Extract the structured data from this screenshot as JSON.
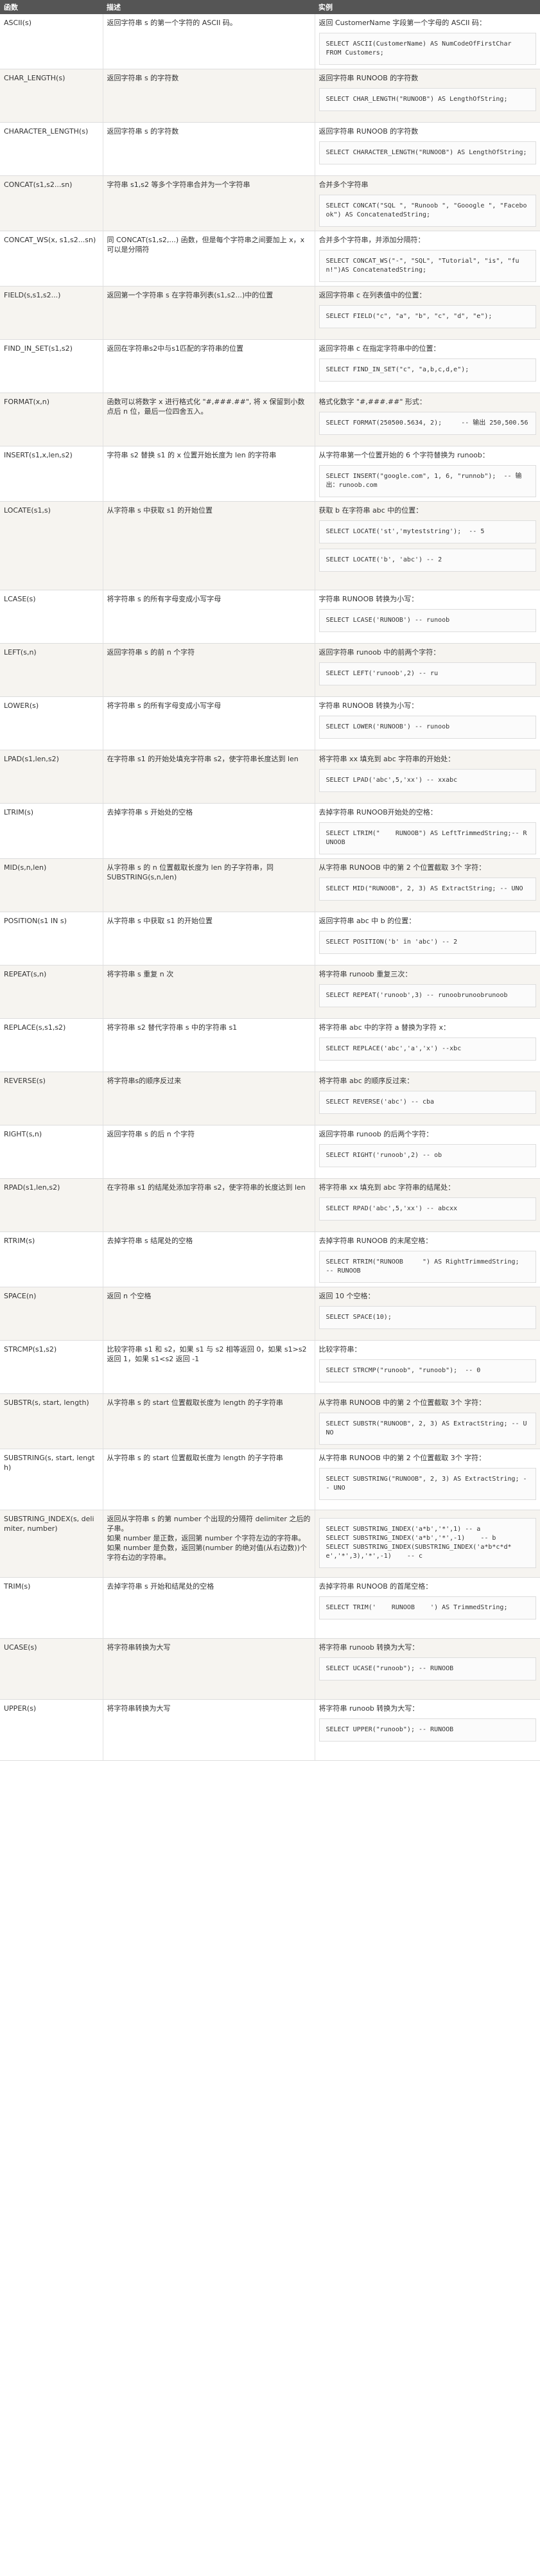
{
  "headers": [
    "函数",
    "描述",
    "实例"
  ],
  "rows": [
    {
      "fn": "ASCII(s)",
      "desc": "返回字符串 s 的第一个字符的 ASCII 码。",
      "example": "返回 CustomerName 字段第一个字母的 ASCII 码：",
      "codes": [
        "SELECT ASCII(CustomerName) AS NumCodeOfFirstChar\nFROM Customers;"
      ],
      "h": 75
    },
    {
      "fn": "CHAR_LENGTH(s)",
      "desc": "返回字符串 s 的字符数",
      "example": "返回字符串 RUNOOB 的字符数",
      "codes": [
        "SELECT CHAR_LENGTH(\"RUNOOB\") AS LengthOfString;"
      ],
      "h": 83
    },
    {
      "fn": "CHARACTER_LENGTH(s)",
      "desc": "返回字符串 s 的字符数",
      "example": "返回字符串 RUNOOB 的字符数",
      "codes": [
        "SELECT CHARACTER_LENGTH(\"RUNOOB\") AS LengthOfString;"
      ],
      "h": 83
    },
    {
      "fn": "CONCAT(s1,s2...sn)",
      "desc": "字符串 s1,s2 等多个字符串合并为一个字符串",
      "example": "合并多个字符串",
      "codes": [
        "SELECT CONCAT(\"SQL \", \"Runoob \", \"Gooogle \", \"Facebook\") AS ConcatenatedString;"
      ],
      "h": 83
    },
    {
      "fn": "CONCAT_WS(x, s1,s2...sn)",
      "desc": "同 CONCAT(s1,s2,...) 函数，但是每个字符串之间要加上 x，x 可以是分隔符",
      "example": "合并多个字符串，并添加分隔符：",
      "codes": [
        "SELECT CONCAT_WS(\"-\", \"SQL\", \"Tutorial\", \"is\", \"fun!\")AS ConcatenatedString;"
      ],
      "h": 83
    },
    {
      "fn": "FIELD(s,s1,s2...)",
      "desc": "返回第一个字符串 s 在字符串列表(s1,s2...)中的位置",
      "example": "返回字符串 c 在列表值中的位置：",
      "codes": [
        "SELECT FIELD(\"c\", \"a\", \"b\", \"c\", \"d\", \"e\");"
      ],
      "h": 83
    },
    {
      "fn": "FIND_IN_SET(s1,s2)",
      "desc": "返回在字符串s2中与s1匹配的字符串的位置",
      "example": "返回字符串 c 在指定字符串中的位置：",
      "codes": [
        "SELECT FIND_IN_SET(\"c\", \"a,b,c,d,e\");"
      ],
      "h": 83
    },
    {
      "fn": "FORMAT(x,n)",
      "desc": "函数可以将数字 x 进行格式化 \"#,###.##\", 将 x 保留到小数点后 n 位，最后一位四舍五入。",
      "example": "格式化数字 \"#,###.##\" 形式：",
      "codes": [
        "SELECT FORMAT(250500.5634, 2);     -- 输出 250,500.56"
      ],
      "h": 83
    },
    {
      "fn": "INSERT(s1,x,len,s2)",
      "desc": "字符串 s2 替换 s1 的 x 位置开始长度为 len 的字符串",
      "example": "从字符串第一个位置开始的 6 个字符替换为 runoob：",
      "codes": [
        "SELECT INSERT(\"google.com\", 1, 6, \"runnob\");  -- 输出：runoob.com"
      ],
      "h": 83
    },
    {
      "fn": "LOCATE(s1,s)",
      "desc": "从字符串 s 中获取 s1 的开始位置",
      "example": "获取 b 在字符串 abc 中的位置：",
      "codes": [
        "SELECT LOCATE('st','myteststring');  -- 5",
        "SELECT LOCATE('b', 'abc') -- 2"
      ],
      "h": 138
    },
    {
      "fn": "LCASE(s)",
      "desc": "将字符串 s 的所有字母变成小写字母",
      "example": "字符串 RUNOOB 转换为小写：",
      "codes": [
        "SELECT LCASE('RUNOOB') -- runoob"
      ],
      "h": 83
    },
    {
      "fn": "LEFT(s,n)",
      "desc": "返回字符串 s 的前 n 个字符",
      "example": "返回字符串 runoob 中的前两个字符：",
      "codes": [
        "SELECT LEFT('runoob',2) -- ru"
      ],
      "h": 83
    },
    {
      "fn": "LOWER(s)",
      "desc": "将字符串 s 的所有字母变成小写字母",
      "example": "字符串 RUNOOB 转换为小写：",
      "codes": [
        "SELECT LOWER('RUNOOB') -- runoob"
      ],
      "h": 83
    },
    {
      "fn": "LPAD(s1,len,s2)",
      "desc": "在字符串 s1 的开始处填充字符串 s2，使字符串长度达到 len",
      "example": "将字符串 xx 填充到 abc 字符串的开始处：",
      "codes": [
        "SELECT LPAD('abc',5,'xx') -- xxabc"
      ],
      "h": 83
    },
    {
      "fn": "LTRIM(s)",
      "desc": "去掉字符串 s 开始处的空格",
      "example": "去掉字符串 RUNOOB开始处的空格：",
      "codes": [
        "SELECT LTRIM(\"    RUNOOB\") AS LeftTrimmedString;-- RUNOOB"
      ],
      "h": 83
    },
    {
      "fn": "MID(s,n,len)",
      "desc": "从字符串 s 的 n 位置截取长度为 len 的子字符串，同 SUBSTRING(s,n,len)",
      "example": "从字符串 RUNOOB 中的第 2 个位置截取 3个 字符：",
      "codes": [
        "SELECT MID(\"RUNOOB\", 2, 3) AS ExtractString; -- UNO"
      ],
      "h": 83
    },
    {
      "fn": "POSITION(s1 IN s)",
      "desc": "从字符串 s 中获取 s1 的开始位置",
      "example": "返回字符串 abc 中 b 的位置：",
      "codes": [
        "SELECT POSITION('b' in 'abc') -- 2"
      ],
      "h": 83
    },
    {
      "fn": "REPEAT(s,n)",
      "desc": "将字符串 s 重复 n 次",
      "example": "将字符串 runoob 重复三次：",
      "codes": [
        "SELECT REPEAT('runoob',3) -- runoobrunoobrunoob"
      ],
      "h": 83
    },
    {
      "fn": "REPLACE(s,s1,s2)",
      "desc": "将字符串 s2 替代字符串 s 中的字符串 s1",
      "example": "将字符串 abc 中的字符 a 替换为字符 x：",
      "codes": [
        "SELECT REPLACE('abc','a','x') --xbc"
      ],
      "h": 83
    },
    {
      "fn": "REVERSE(s)",
      "desc": "将字符串s的顺序反过来",
      "example": "将字符串 abc 的顺序反过来：",
      "codes": [
        "SELECT REVERSE('abc') -- cba"
      ],
      "h": 83
    },
    {
      "fn": "RIGHT(s,n)",
      "desc": "返回字符串 s 的后 n 个字符",
      "example": "返回字符串 runoob 的后两个字符：",
      "codes": [
        "SELECT RIGHT('runoob',2) -- ob"
      ],
      "h": 83
    },
    {
      "fn": "RPAD(s1,len,s2)",
      "desc": "在字符串 s1 的结尾处添加字符串 s2，使字符串的长度达到 len",
      "example": "将字符串 xx 填充到 abc 字符串的结尾处：",
      "codes": [
        "SELECT RPAD('abc',5,'xx') -- abcxx"
      ],
      "h": 83
    },
    {
      "fn": "RTRIM(s)",
      "desc": "去掉字符串 s 结尾处的空格",
      "example": "去掉字符串 RUNOOB 的末尾空格：",
      "codes": [
        "SELECT RTRIM(\"RUNOOB     \") AS RightTrimmedString;   -- RUNOOB"
      ],
      "h": 83
    },
    {
      "fn": "SPACE(n)",
      "desc": "返回 n 个空格",
      "example": "返回 10 个空格：",
      "codes": [
        "SELECT SPACE(10);"
      ],
      "h": 83
    },
    {
      "fn": "STRCMP(s1,s2)",
      "desc": "比较字符串 s1 和 s2，如果 s1 与 s2 相等返回 0，如果 s1>s2 返回 1，如果 s1<s2 返回 -1",
      "example": "比较字符串：",
      "codes": [
        "SELECT STRCMP(\"runoob\", \"runoob\");  -- 0"
      ],
      "h": 83
    },
    {
      "fn": "SUBSTR(s, start, length)",
      "desc": "从字符串 s 的 start 位置截取长度为 length 的子字符串",
      "example": "从字符串 RUNOOB 中的第 2 个位置截取 3个 字符：",
      "codes": [
        "SELECT SUBSTR(\"RUNOOB\", 2, 3) AS ExtractString; -- UNO"
      ],
      "h": 83
    },
    {
      "fn": "SUBSTRING(s, start, length)",
      "desc": "从字符串 s 的 start 位置截取长度为 length 的子字符串",
      "example": "从字符串 RUNOOB 中的第 2 个位置截取 3个 字符：",
      "codes": [
        "SELECT SUBSTRING(\"RUNOOB\", 2, 3) AS ExtractString; -- UNO"
      ],
      "h": 95
    },
    {
      "fn": "SUBSTRING_INDEX(s, delimiter, number)",
      "desc": "返回从字符串 s 的第 number 个出现的分隔符 delimiter 之后的子串。\n如果 number 是正数，返回第 number 个字符左边的字符串。\n如果 number 是负数，返回第(number 的绝对值(从右边数))个字符右边的字符串。",
      "example": "",
      "codes": [
        "SELECT SUBSTRING_INDEX('a*b','*',1) -- a\nSELECT SUBSTRING_INDEX('a*b','*',-1)    -- b\nSELECT SUBSTRING_INDEX(SUBSTRING_INDEX('a*b*c*d*e','*',3),'*',-1)    -- c"
      ],
      "h": 105
    },
    {
      "fn": "TRIM(s)",
      "desc": "去掉字符串 s 开始和结尾处的空格",
      "example": "去掉字符串 RUNOOB 的首尾空格：",
      "codes": [
        "SELECT TRIM('    RUNOOB    ') AS TrimmedString;"
      ],
      "h": 95
    },
    {
      "fn": "UCASE(s)",
      "desc": "将字符串转换为大写",
      "example": "将字符串 runoob 转换为大写：",
      "codes": [
        "SELECT UCASE(\"runoob\"); -- RUNOOB"
      ],
      "h": 95
    },
    {
      "fn": "UPPER(s)",
      "desc": "将字符串转换为大写",
      "example": "将字符串 runoob 转换为大写：",
      "codes": [
        "SELECT UPPER(\"runoob\"); -- RUNOOB"
      ],
      "h": 95
    }
  ]
}
